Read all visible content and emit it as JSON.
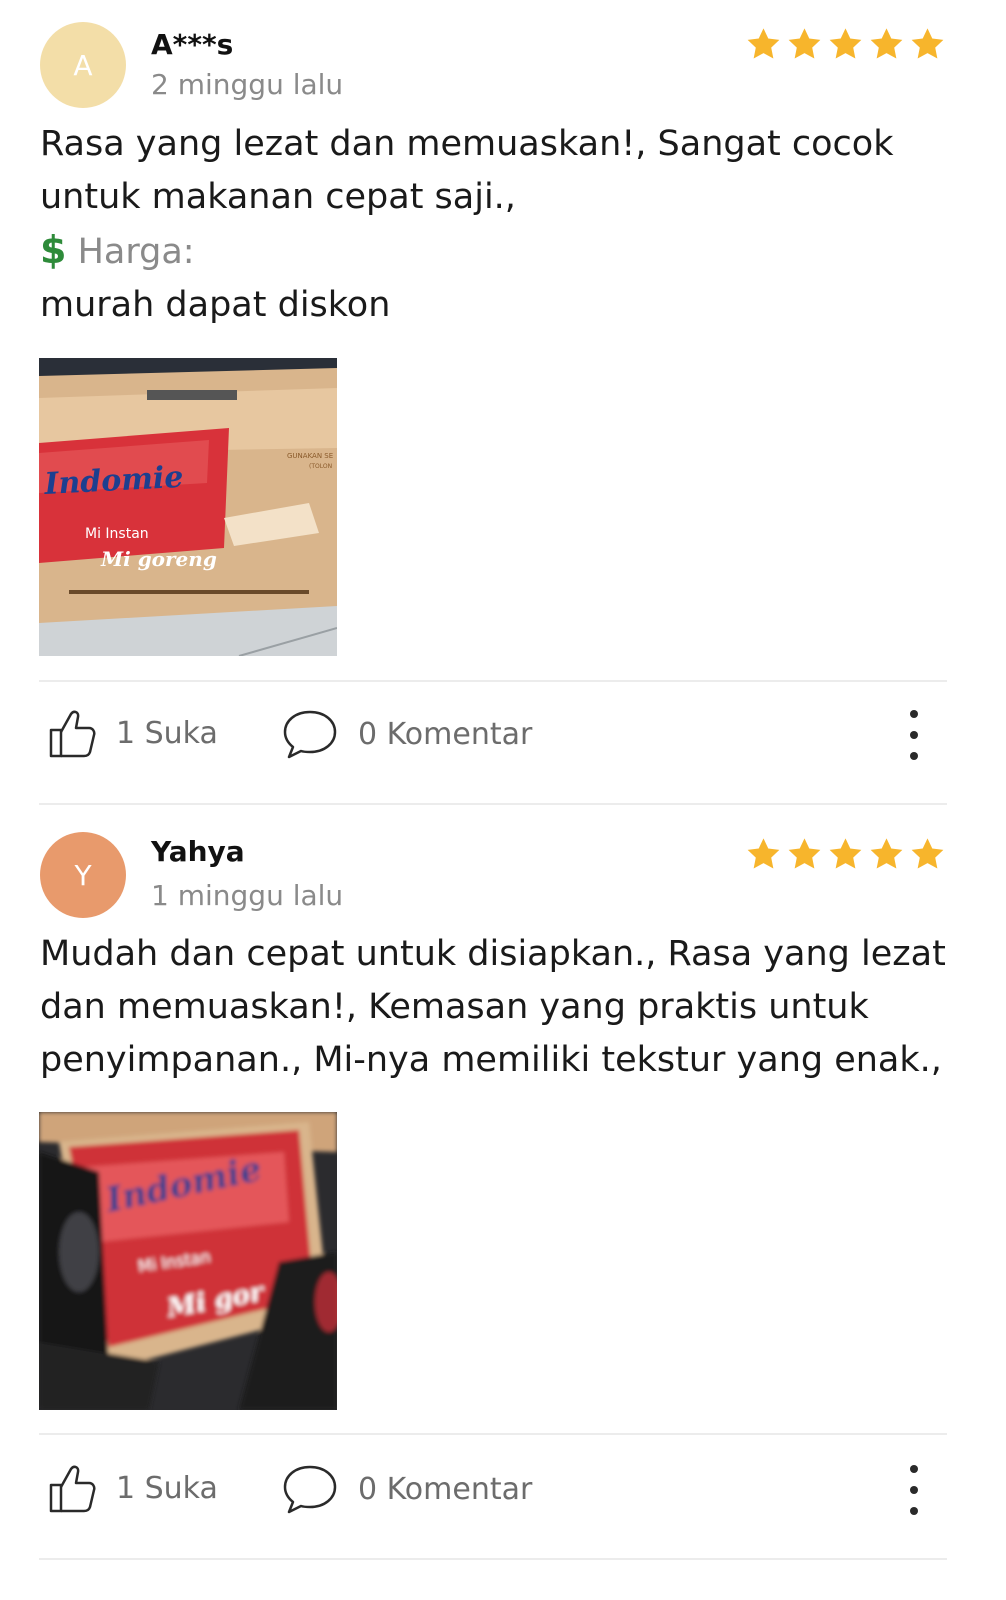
{
  "reviews": [
    {
      "avatar_letter": "A",
      "avatar_color": "#f3dea8",
      "name": "A***s",
      "date": "2 minggu lalu",
      "rating": 5,
      "text_line1": "Rasa yang lezat dan memuaskan!, Sangat cocok",
      "text_line2": "untuk makanan cepat saji.,",
      "price_icon": "dollar-icon",
      "price_label": "Harga:",
      "price_value": "murah dapat diskon",
      "photo": {
        "brand": "Indomie",
        "line1": "Mi Instan",
        "line2": "Mi goreng",
        "side_text": "GUNAKAN SE",
        "side_text2": "(TOLON"
      },
      "likes": "1 Suka",
      "comments": "0 Komentar"
    },
    {
      "avatar_letter": "Y",
      "avatar_color": "#e89a6c",
      "name": "Yahya",
      "date": "1 minggu lalu",
      "rating": 5,
      "text_line1": "Mudah dan cepat untuk disiapkan., Rasa yang lezat",
      "text_line2": "dan memuaskan!, Kemasan yang praktis untuk",
      "text_line3": "penyimpanan., Mi-nya memiliki tekstur yang enak.,",
      "photo": {
        "brand": "Indomie",
        "line1": "Mi Instan",
        "line2": "Mi gor"
      },
      "likes": "1 Suka",
      "comments": "0 Komentar"
    }
  ],
  "colors": {
    "star": "#f7b52c",
    "muted": "#8a8a8a",
    "divider": "#ececec",
    "indomie_red": "#d8323a"
  }
}
